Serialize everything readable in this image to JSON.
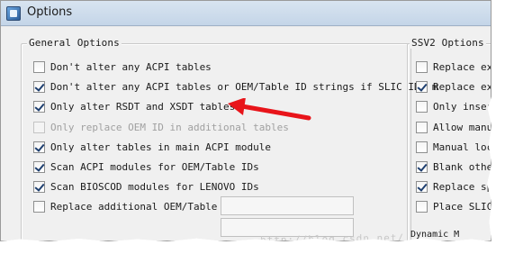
{
  "window": {
    "title": "Options"
  },
  "general": {
    "label": "General Options",
    "options": [
      {
        "label": "Don't alter any ACPI tables",
        "checked": false,
        "enabled": true
      },
      {
        "label": "Don't alter any ACPI tables or OEM/Table ID strings if SLIC IDs m",
        "checked": true,
        "enabled": true
      },
      {
        "label": "Only alter RSDT and XSDT tables",
        "checked": true,
        "enabled": true
      },
      {
        "label": "Only replace OEM ID in additional tables",
        "checked": false,
        "enabled": false
      },
      {
        "label": "Only alter tables in main ACPI module",
        "checked": true,
        "enabled": true
      },
      {
        "label": "Scan ACPI modules for OEM/Table IDs",
        "checked": true,
        "enabled": true
      },
      {
        "label": "Scan BIOSCOD modules for LENOVO IDs",
        "checked": true,
        "enabled": true
      },
      {
        "label": "Replace additional OEM/Table ID",
        "checked": false,
        "enabled": true
      }
    ]
  },
  "ssv2": {
    "label": "SSV2 Options",
    "options": [
      {
        "label": "Replace exi",
        "checked": false
      },
      {
        "label": "Replace exi",
        "checked": true
      },
      {
        "label": "Only insert",
        "checked": false
      },
      {
        "label": "Allow manua",
        "checked": false
      },
      {
        "label": "Manual loca",
        "checked": false
      },
      {
        "label": "Blank other",
        "checked": true
      },
      {
        "label": "Replace spe",
        "checked": true
      },
      {
        "label": "Place SLIC",
        "checked": false
      }
    ]
  },
  "footer": {
    "dynamic_label": "Dynamic M",
    "watermark": "http://blog.csdn.net/"
  },
  "colors": {
    "arrow": "#e8141a"
  }
}
